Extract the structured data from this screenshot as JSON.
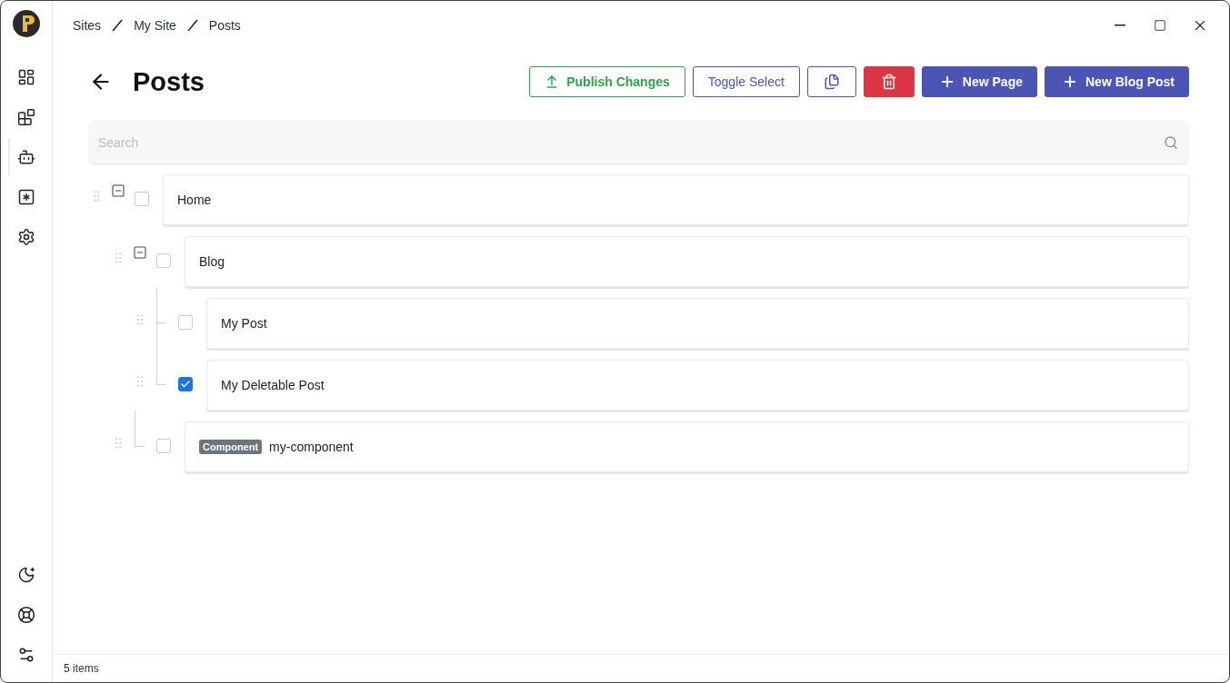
{
  "breadcrumb": [
    "Sites",
    "My Site",
    "Posts"
  ],
  "sidebar": {
    "top": [
      {
        "kind": "dashboard",
        "selected": false
      },
      {
        "kind": "blocks",
        "selected": false
      },
      {
        "kind": "bot",
        "selected": true
      },
      {
        "kind": "asterisk",
        "selected": false
      },
      {
        "kind": "settings",
        "selected": false
      }
    ],
    "bottom": [
      {
        "kind": "theme"
      },
      {
        "kind": "help"
      },
      {
        "kind": "preferences"
      }
    ]
  },
  "title": "Posts",
  "actions": [
    {
      "kind": "outline-success",
      "label": "Publish Changes"
    },
    {
      "kind": "outline",
      "label": "Toggle Select"
    },
    {
      "kind": "copy"
    },
    {
      "kind": "delete"
    },
    {
      "kind": "primary",
      "label": "New Page"
    },
    {
      "kind": "primary",
      "label": "New Blog Post"
    }
  ],
  "search": {
    "placeholder": "Search"
  },
  "tree": [
    {
      "label": "Home",
      "checked": false,
      "expanded": true,
      "children": [
        {
          "label": "Blog",
          "checked": false,
          "expanded": true,
          "children": [
            {
              "label": "My Post",
              "checked": false
            },
            {
              "label": "My Deletable Post",
              "checked": true
            }
          ]
        },
        {
          "label": "my-component",
          "tag": "Component",
          "checked": false
        }
      ]
    }
  ],
  "status_bar": "5 items"
}
